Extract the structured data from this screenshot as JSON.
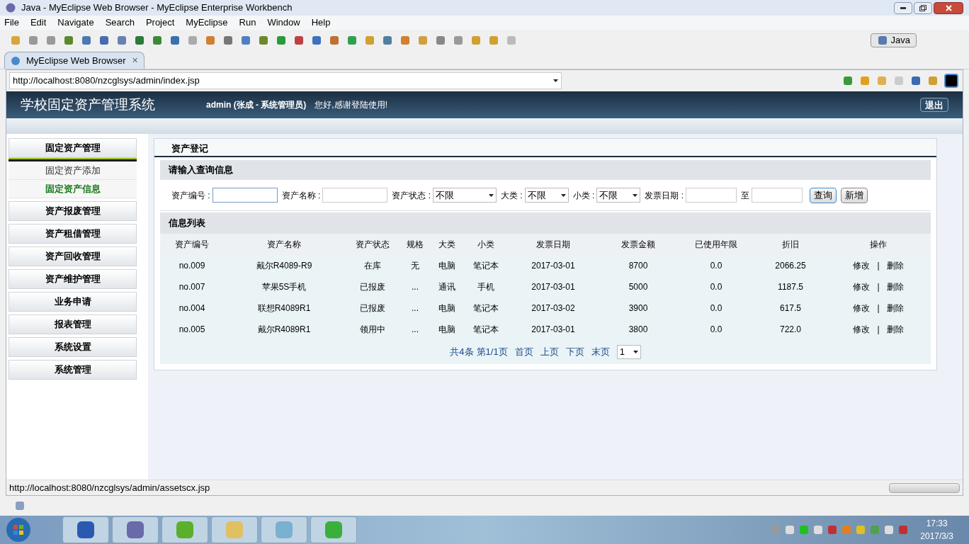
{
  "window": {
    "title": "Java - MyEclipse Web Browser - MyEclipse Enterprise Workbench"
  },
  "menu": [
    "File",
    "Edit",
    "Navigate",
    "Search",
    "Project",
    "MyEclipse",
    "Run",
    "Window",
    "Help"
  ],
  "perspective": {
    "label": "Java"
  },
  "editor_tab": {
    "label": "MyEclipse Web Browser",
    "close": "✕"
  },
  "address": {
    "value": "http://localhost:8080/nzcglsys/admin/index.jsp"
  },
  "app_header": {
    "title": "学校固定资产管理系统",
    "user": "admin (张成  - 系统管理员)",
    "greeting": "您好,感谢登陆使用!",
    "logout": "退出"
  },
  "sidebar": [
    {
      "label": "固定资产管理",
      "expanded": true,
      "children": [
        {
          "label": "固定资产添加",
          "selected": false
        },
        {
          "label": "固定资产信息",
          "selected": true
        }
      ]
    },
    {
      "label": "资产报废管理",
      "expanded": false
    },
    {
      "label": "资产租借管理",
      "expanded": false
    },
    {
      "label": "资产回收管理",
      "expanded": false
    },
    {
      "label": "资产维护管理",
      "expanded": false
    },
    {
      "label": "业务申请",
      "expanded": false
    },
    {
      "label": "报表管理",
      "expanded": false
    },
    {
      "label": "系统设置",
      "expanded": false
    },
    {
      "label": "系统管理",
      "expanded": false
    }
  ],
  "panel_title": "资产登记",
  "query": {
    "heading": "请输入查询信息",
    "fields": [
      {
        "kind": "text",
        "label": "资产编号 :"
      },
      {
        "kind": "text",
        "label": "资产名称 :"
      },
      {
        "kind": "select",
        "label": "资产状态 :",
        "value": "不限"
      },
      {
        "kind": "select",
        "label": "大类 :",
        "value": "不限"
      },
      {
        "kind": "select",
        "label": "小类 :",
        "value": "不限"
      },
      {
        "kind": "text",
        "label": "发票日期 :"
      },
      {
        "kind": "text",
        "label": "至"
      }
    ],
    "buttons": [
      "查询",
      "新增"
    ]
  },
  "list": {
    "heading": "信息列表",
    "columns": [
      "资产编号",
      "资产名称",
      "资产状态",
      "规格",
      "大类",
      "小类",
      "发票日期",
      "发票金额",
      "已使用年限",
      "折旧",
      "操作"
    ],
    "rows": [
      {
        "cells": [
          "no.009",
          "戴尔R4089-R9",
          "在库",
          "无",
          "电脑",
          "笔记本",
          "2017-03-01",
          "8700",
          "0.0",
          "2066.25"
        ],
        "actions": [
          "修改",
          "|",
          "删除"
        ]
      },
      {
        "cells": [
          "no.007",
          "苹果5S手机",
          "已报废",
          "...",
          "通讯",
          "手机",
          "2017-03-01",
          "5000",
          "0.0",
          "1187.5"
        ],
        "actions": [
          "修改",
          "|",
          "删除"
        ]
      },
      {
        "cells": [
          "no.004",
          "联想R4089R1",
          "已报废",
          "...",
          "电脑",
          "笔记本",
          "2017-03-02",
          "3900",
          "0.0",
          "617.5"
        ],
        "actions": [
          "修改",
          "|",
          "删除"
        ]
      },
      {
        "cells": [
          "no.005",
          "戴尔R4089R1",
          "领用中",
          "...",
          "电脑",
          "笔记本",
          "2017-03-01",
          "3800",
          "0.0",
          "722.0"
        ],
        "actions": [
          "修改",
          "|",
          "删除"
        ]
      }
    ],
    "pager": {
      "total": "共4条",
      "page": "第1/1页",
      "links": [
        "首页",
        "上页",
        "下页",
        "末页"
      ],
      "select": "1"
    }
  },
  "progress": {
    "level": 0
  },
  "status_url": "http://localhost:8080/nzcglsys/admin/assetscx.jsp",
  "taskbar": {
    "time": "17:33",
    "date": "2017/3/3"
  }
}
